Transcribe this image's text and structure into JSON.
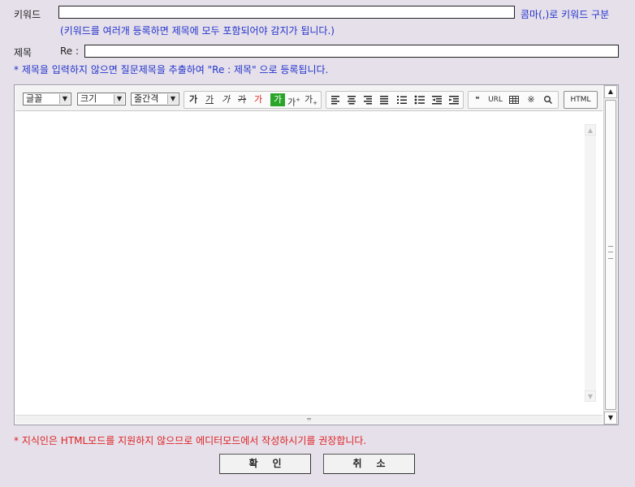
{
  "keyword": {
    "label": "키워드",
    "value": "",
    "hint": "콤마(,)로 키워드 구분",
    "note": "(키워드를 여러개 등록하면 제목에 모두 포함되어야 감지가 됩니다.)"
  },
  "title": {
    "label": "제목",
    "prefix": "Re :",
    "value": "",
    "note": "* 제목을 입력하지 않으면 질문제목을 추출하여 \"Re : 제목\" 으로 등록됩니다."
  },
  "toolbar": {
    "font_select": "글꼴",
    "size_select": "크기",
    "line_select": "줄간격",
    "format_buttons": [
      "가",
      "가",
      "가",
      "가",
      "가",
      "가",
      "가",
      "가"
    ],
    "quote_label": "66",
    "url_label": "URL",
    "special_char_label": "※",
    "html_label": "HTML",
    "icons": [
      "bold-icon",
      "underline-icon",
      "italic-icon",
      "strike-icon",
      "font-color-icon",
      "bg-color-icon",
      "superscript-icon",
      "subscript-icon",
      "align-left-icon",
      "align-center-icon",
      "align-right-icon",
      "align-justify-icon",
      "ordered-list-icon",
      "unordered-list-icon",
      "outdent-icon",
      "indent-icon",
      "quote-icon",
      "link-icon",
      "table-icon",
      "special-char-icon",
      "search-icon"
    ]
  },
  "warning": "* 지식인은 HTML모드를 지원하지 않으므로 에디터모드에서 작성하시기를 권장합니다.",
  "buttons": {
    "confirm": "확인",
    "cancel": "취소"
  },
  "colors": {
    "background": "#e6e0ea",
    "link_blue": "#2233cc",
    "warning_red": "#dd2222",
    "active_green": "#2aa52a"
  }
}
